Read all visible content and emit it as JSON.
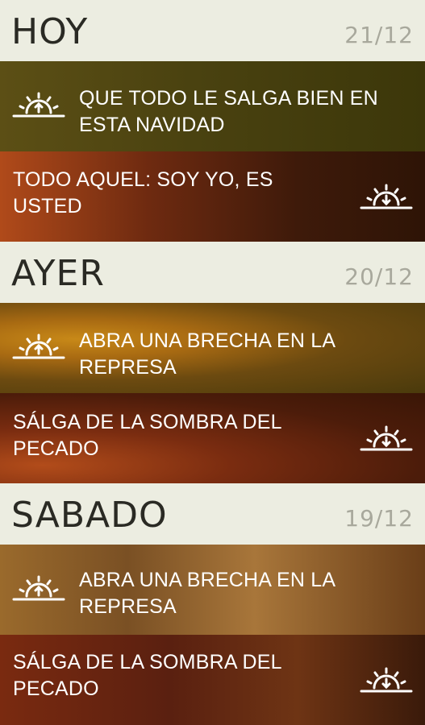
{
  "days": [
    {
      "name": "HOY",
      "date": "21/12",
      "morning": {
        "title": "QUE TODO LE SALGA BIEN EN ESTA NAVIDAD",
        "icon": "sunrise-icon"
      },
      "evening": {
        "title": "TODO AQUEL: SOY YO, ES USTED",
        "icon": "sunset-icon"
      }
    },
    {
      "name": "AYER",
      "date": "20/12",
      "morning": {
        "title": "ABRA UNA BRECHA EN LA REPRESA",
        "icon": "sunrise-icon"
      },
      "evening": {
        "title": "SÁLGA DE LA SOMBRA DEL PECADO",
        "icon": "sunset-icon"
      }
    },
    {
      "name": "SABADO",
      "date": "19/12",
      "morning": {
        "title": "ABRA UNA BRECHA EN LA REPRESA",
        "icon": "sunrise-icon"
      },
      "evening": {
        "title": "SÁLGA DE LA SOMBRA DEL PECADO",
        "icon": "sunset-icon"
      }
    }
  ]
}
